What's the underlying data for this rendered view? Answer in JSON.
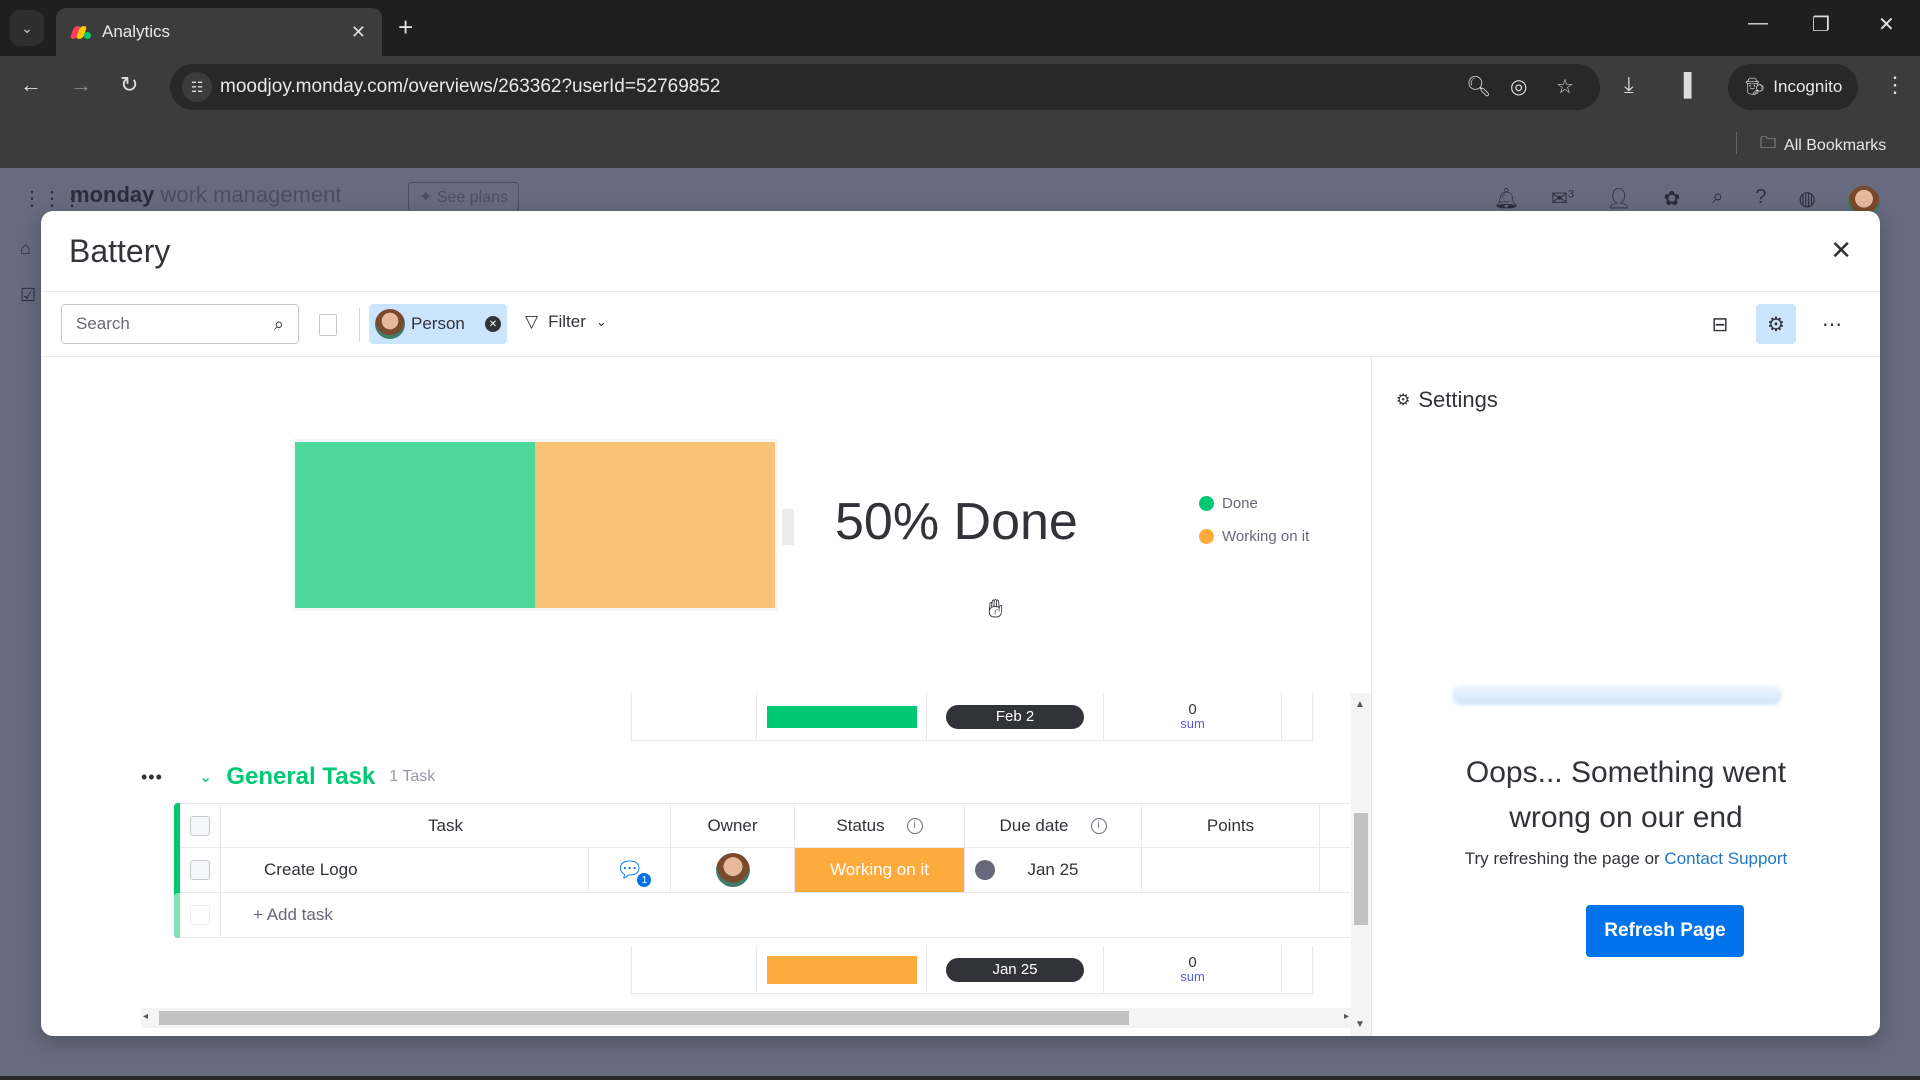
{
  "browser": {
    "tab_title": "Analytics",
    "url": "moodjoy.monday.com/overviews/263362?userId=52769852",
    "incognito_label": "Incognito",
    "bookmarks_label": "All Bookmarks"
  },
  "app": {
    "logo_bold": "monday",
    "logo_light": "work management",
    "see_plans_label": "See plans",
    "inbox_badge": "3"
  },
  "modal": {
    "title": "Battery",
    "search_placeholder": "Search",
    "person_filter_label": "Person",
    "filter_label": "Filter"
  },
  "battery_widget": {
    "done_text": "50% Done",
    "segments": [
      {
        "label": "Done",
        "fraction": 0.5,
        "color": "#4fd89c"
      },
      {
        "label": "Working on it",
        "fraction": 0.5,
        "color": "#f9c377"
      }
    ],
    "legend": [
      {
        "label": "Done",
        "color": "#00c875"
      },
      {
        "label": "Working on it",
        "color": "#fdab3d"
      }
    ]
  },
  "board": {
    "top_summary": {
      "status_color": "#00c875",
      "date": "Feb 2",
      "points": "0",
      "points_label": "sum"
    },
    "group": {
      "title": "General Task",
      "count": "1 Task",
      "color": "#00c875",
      "columns": [
        "Task",
        "Owner",
        "Status",
        "Due date",
        "Points"
      ],
      "rows": [
        {
          "task": "Create Logo",
          "updates": "1",
          "status": "Working on it",
          "status_color": "#fdab3d",
          "due_date": "Jan 25",
          "points": ""
        }
      ],
      "add_task_label": "+ Add task",
      "summary": {
        "status_color": "#fdab3d",
        "date": "Jan 25",
        "points": "0",
        "points_label": "sum"
      }
    }
  },
  "settings": {
    "title": "Settings",
    "error_title": "Oops... Something went wrong on our end",
    "error_sub": "Try refreshing the page or ",
    "contact_link": "Contact Support",
    "refresh_label": "Refresh Page"
  }
}
